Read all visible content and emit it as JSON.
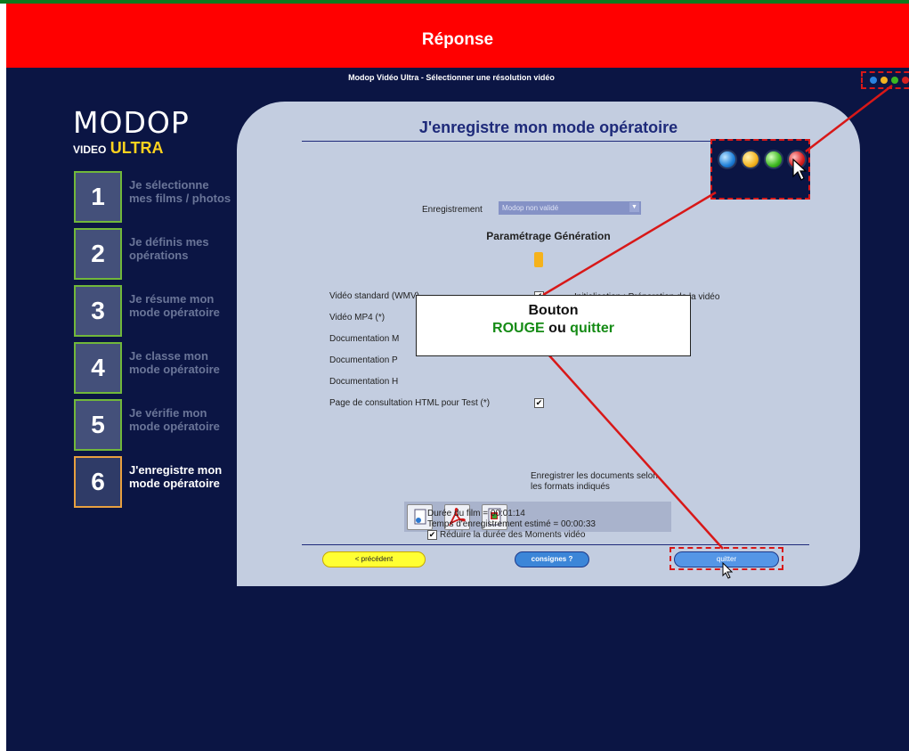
{
  "banner": {
    "title": "Réponse"
  },
  "window": {
    "title": "Modop Vidéo Ultra - Sélectionner une résolution vidéo"
  },
  "logo": {
    "main": "MODOP",
    "video": "VIDEO",
    "ultra": "ULTRA"
  },
  "steps": [
    {
      "num": "1",
      "line1": "Je sélectionne",
      "line2": "mes films / photos"
    },
    {
      "num": "2",
      "line1": "Je définis mes",
      "line2": "opérations"
    },
    {
      "num": "3",
      "line1": "Je résume mon",
      "line2": "mode opératoire"
    },
    {
      "num": "4",
      "line1": "Je classe mon",
      "line2": "mode opératoire"
    },
    {
      "num": "5",
      "line1": "Je vérifie mon",
      "line2": "mode opératoire"
    },
    {
      "num": "6",
      "line1": "J'enregistre mon",
      "line2": "mode opératoire"
    }
  ],
  "panel": {
    "title": "J'enregistre mon mode opératoire",
    "enregistrement_label": "Enregistrement",
    "enregistrement_value": "Modop non validé",
    "section_title": "Paramétrage Génération",
    "status": "Initialisation : Préparation de la vidéo",
    "options": [
      {
        "label": "Vidéo standard (WMV)",
        "checked": true
      },
      {
        "label": "Vidéo MP4 (*)",
        "checked": true
      },
      {
        "label": "Documentation M",
        "checked": false
      },
      {
        "label": "Documentation P",
        "checked": false
      },
      {
        "label": "Documentation H",
        "checked": false
      },
      {
        "label": "Page de consultation HTML pour Test (*)",
        "checked": true
      }
    ],
    "export_text_1": "Enregistrer les documents selon",
    "export_text_2": "les formats indiqués",
    "duree": "Durée du film = 00:01:14",
    "temps": "Temps d'enregistrement estimé = 00:00:33",
    "reduire": "Réduire la durée des Moments vidéo",
    "checkmark": "✔"
  },
  "buttons": {
    "prev": "< précédent",
    "help": "consignes ?",
    "quit": "quitter"
  },
  "callout": {
    "line1": "Bouton",
    "rouge": "ROUGE",
    "ou": "ou",
    "quitter": "quitter"
  },
  "colors": {
    "banner": "#ff0000",
    "app_bg": "#0b1544",
    "panel": "#c3cde0",
    "step_border": "#71b83a",
    "step_active_border": "#e8a040",
    "annotation": "#d81818"
  }
}
